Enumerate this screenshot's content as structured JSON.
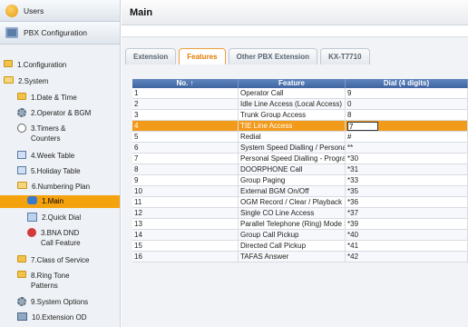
{
  "sidebar": {
    "users_label": "Users",
    "pbx_label": "PBX Configuration",
    "items": [
      {
        "label": "1.Configuration",
        "icon": "folder-icon"
      },
      {
        "label": "2.System",
        "icon": "folder-open-icon"
      },
      {
        "label": "1.Date & Time",
        "icon": "folder-icon"
      },
      {
        "label": "2.Operator & BGM",
        "icon": "settings-icon"
      },
      {
        "label": "3.Timers & Counters",
        "icon": "clock-icon"
      },
      {
        "label": "4.Week Table",
        "icon": "calendar-icon"
      },
      {
        "label": "5.Holiday Table",
        "icon": "calendar-icon"
      },
      {
        "label": "6.Numbering Plan",
        "icon": "folder-open-icon"
      },
      {
        "label": "1.Main",
        "icon": "phone-icon"
      },
      {
        "label": "2.Quick Dial",
        "icon": "page-icon"
      },
      {
        "label": "3.BNA DND Call Feature",
        "icon": "dnd-icon"
      },
      {
        "label": "7.Class of Service",
        "icon": "folder-icon"
      },
      {
        "label": "8.Ring Tone Patterns",
        "icon": "folder-icon"
      },
      {
        "label": "9.System Options",
        "icon": "settings-icon"
      },
      {
        "label": "10.Extension OD",
        "icon": "book-icon"
      }
    ]
  },
  "main": {
    "title": "Main",
    "tabs": [
      "Extension",
      "Features",
      "Other PBX Extension",
      "KX-T7710"
    ],
    "active_tab": "Features",
    "table": {
      "headers": [
        "No. ↑",
        "Feature",
        "Dial (4 digits)"
      ],
      "rows": [
        {
          "no": "1",
          "feature": "Operator Call",
          "dial": "9"
        },
        {
          "no": "2",
          "feature": "Idle Line Access (Local Access)",
          "dial": "0"
        },
        {
          "no": "3",
          "feature": "Trunk Group Access",
          "dial": "8"
        },
        {
          "no": "4",
          "feature": "TIE Line Access",
          "dial": "7"
        },
        {
          "no": "5",
          "feature": "Redial",
          "dial": "#"
        },
        {
          "no": "6",
          "feature": "System Speed Dialling / Personal Speed Dialling",
          "dial": "**"
        },
        {
          "no": "7",
          "feature": "Personal Speed Dialling - Programming",
          "dial": "*30"
        },
        {
          "no": "8",
          "feature": "DOORPHONE Call",
          "dial": "*31"
        },
        {
          "no": "9",
          "feature": "Group Paging",
          "dial": "*33"
        },
        {
          "no": "10",
          "feature": "External BGM On/Off",
          "dial": "*35"
        },
        {
          "no": "11",
          "feature": "OGM Record / Clear / Playback",
          "dial": "*36"
        },
        {
          "no": "12",
          "feature": "Single CO Line Access",
          "dial": "*37"
        },
        {
          "no": "13",
          "feature": "Parallel Telephone (Ring) Mode Set",
          "dial": "*39"
        },
        {
          "no": "14",
          "feature": "Group Call Pickup",
          "dial": "*40"
        },
        {
          "no": "15",
          "feature": "Directed Call Pickup",
          "dial": "*41"
        },
        {
          "no": "16",
          "feature": "TAFAS Answer",
          "dial": "*42"
        }
      ],
      "selected_row": 3
    }
  },
  "colors": {
    "accent": "#f29a1a",
    "header_blue": "#4a6fae",
    "active_tab_text": "#e07a00"
  }
}
